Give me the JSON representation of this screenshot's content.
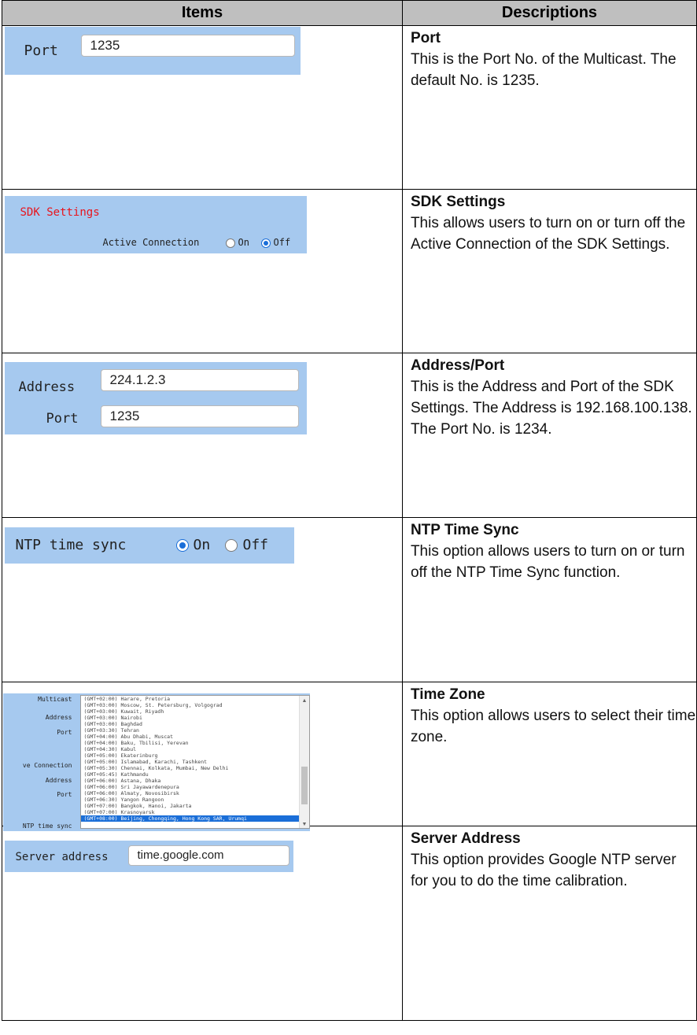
{
  "header": {
    "items": "Items",
    "descriptions": "Descriptions"
  },
  "rows": [
    {
      "title": "Port",
      "body": "This is the Port No. of the Multicast. The default No. is 1235.",
      "ui": {
        "port_label": "Port",
        "port_value": "1235"
      }
    },
    {
      "title": "SDK Settings",
      "body": "This allows users to turn on or turn off the Active Connection of the SDK Settings.",
      "ui": {
        "section_title": "SDK Settings",
        "section_color": "#e8141c",
        "active_label": "Active Connection",
        "on_label": "On",
        "off_label": "Off",
        "selected": "Off"
      }
    },
    {
      "title": "Address/Port",
      "body": "This is the Address and Port of the SDK Settings. The Address is 192.168.100.138. The Port No. is 1234.",
      "ui": {
        "address_label": "Address",
        "address_value": "224.1.2.3",
        "port_label": "Port",
        "port_value": "1235"
      }
    },
    {
      "title": "NTP Time Sync",
      "body": "This option allows users to turn on or turn off the NTP Time Sync function.",
      "ui": {
        "label": "NTP time sync",
        "on_label": "On",
        "off_label": "Off",
        "selected": "On"
      }
    },
    {
      "title": "Time Zone",
      "body": "This option allows users to select their time zone.",
      "ui": {
        "labels": [
          "Multicast",
          "Address",
          "Port",
          "ve Connection",
          "Address",
          "Port",
          "NTP time sync"
        ],
        "options": [
          "(GMT+02:00) Harare, Pretoria",
          "(GMT+03:00) Moscow, St. Petersburg, Volgograd",
          "(GMT+03:00) Kuwait, Riyadh",
          "(GMT+03:00) Nairobi",
          "(GMT+03:00) Baghdad",
          "(GMT+03:30) Tehran",
          "(GMT+04:00) Abu Dhabi, Muscat",
          "(GMT+04:00) Baku, Tbilisi, Yerevan",
          "(GMT+04:30) Kabul",
          "(GMT+05:00) Ekaterinburg",
          "(GMT+05:00) Islamabad, Karachi, Tashkent",
          "(GMT+05:30) Chennai, Kolkata, Mumbai, New Delhi",
          "(GMT+05:45) Kathmandu",
          "(GMT+06:00) Astana, Dhaka",
          "(GMT+06:00) Sri Jayawardenepura",
          "(GMT+06:00) Almaty, Novosibirsk",
          "(GMT+06:30) Yangon Rangoon",
          "(GMT+07:00) Bangkok, Hanoi, Jakarta",
          "(GMT+07:00) Krasnoyarsk",
          "(GMT+08:00) Beijing, Chongqing, Hong Kong SAR, Urumqi"
        ],
        "selected_index": 19,
        "selected_color": "#1a6ed8"
      }
    },
    {
      "title": "Server Address",
      "body": "This option provides Google NTP server for you to do the time calibration.",
      "ui": {
        "label": "Server address",
        "value": "time.google.com"
      }
    }
  ]
}
